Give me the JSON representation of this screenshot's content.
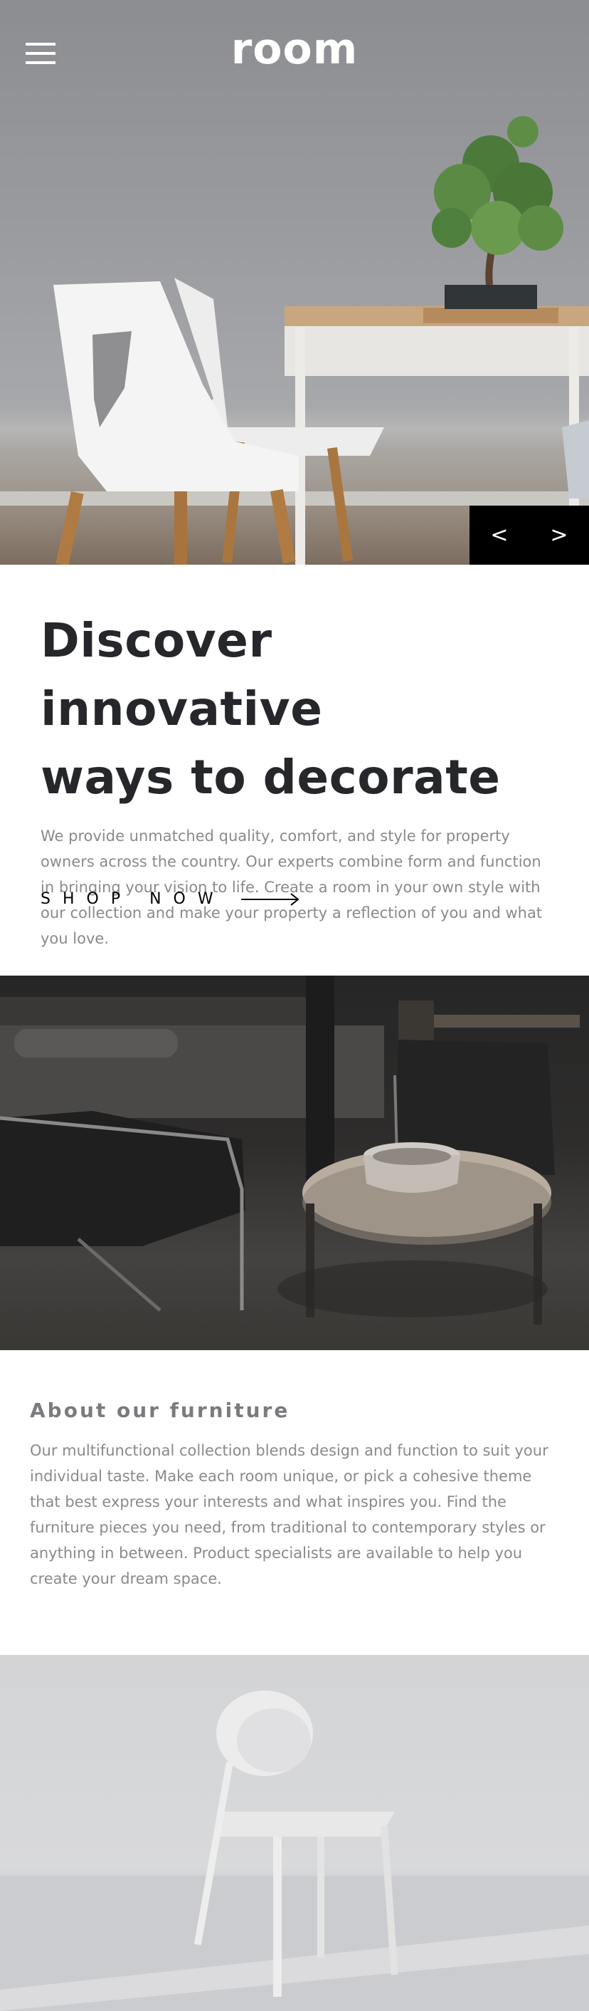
{
  "header": {
    "logo": "room",
    "menu_icon": "hamburger-menu-icon"
  },
  "hero": {
    "image_desc": "white-chairs-wooden-table-bonsai",
    "prev_label": "<",
    "next_label": ">"
  },
  "intro": {
    "title_line1": "Discover innovative",
    "title_line2": "ways to decorate",
    "body": "We provide unmatched quality, comfort, and style for property owners across the country. Our experts combine form and function in bringing your vision to life. Create a room in your own style with our collection and make your property a reflection of you and what you love.",
    "cta_label": "SHOP NOW",
    "cta_icon": "arrow-right-icon"
  },
  "about": {
    "heading": "About our furniture",
    "body": "Our multifunctional collection blends design and function to suit your individual taste. Make each room unique, or pick a cohesive theme that best express your interests and what inspires you. Find the furniture pieces you need, from traditional to contemporary styles or anything in between. Product specialists are available to help you create your dream space."
  },
  "colors": {
    "heading": "#26272b",
    "body_text": "#8a8a8e",
    "slider_bg": "#000000",
    "logo": "#ffffff"
  }
}
